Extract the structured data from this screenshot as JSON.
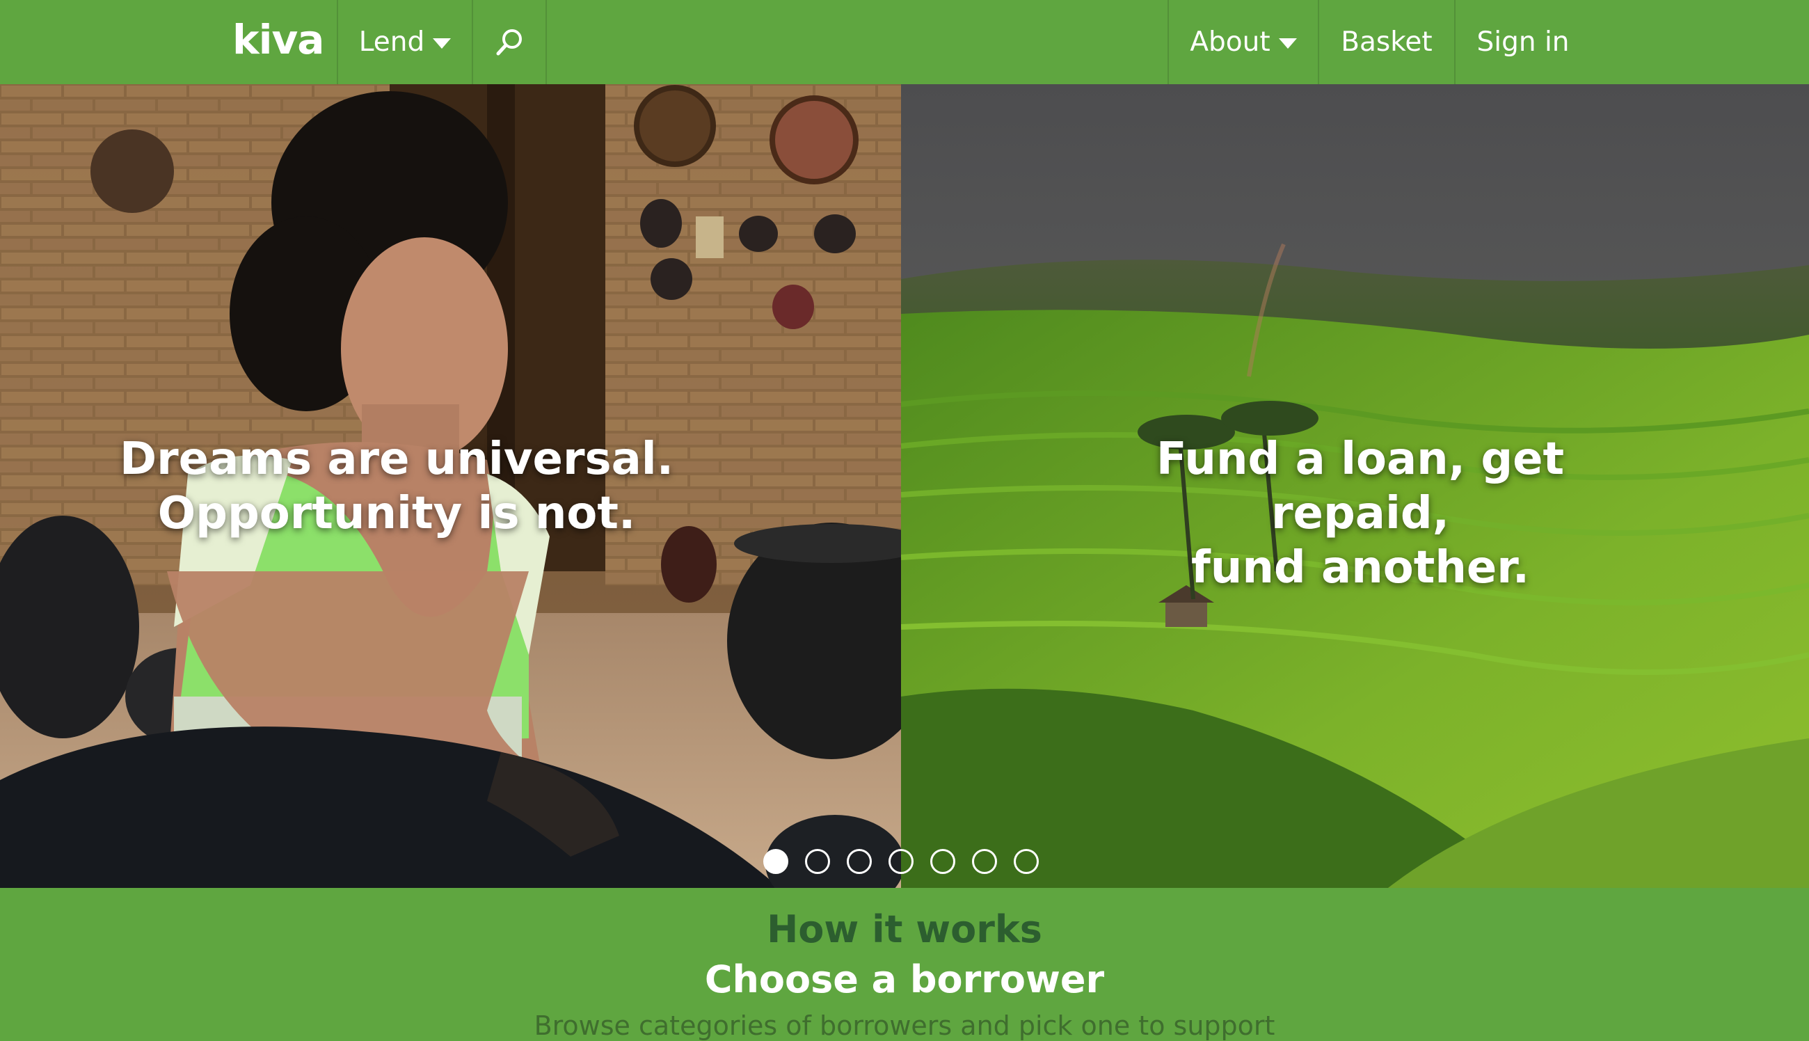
{
  "nav": {
    "logo": "kiva",
    "lend_label": "Lend",
    "search_icon": "search-icon",
    "about_label": "About",
    "basket_label": "Basket",
    "signin_label": "Sign in"
  },
  "hero": {
    "left_line1": "Dreams are universal.",
    "left_line2": "Opportunity is not.",
    "right_line1": "Fund a loan, get repaid,",
    "right_line2": "fund another.",
    "dots": {
      "count": 7,
      "active": 1
    }
  },
  "how": {
    "title": "How it works",
    "subtitle": "Choose a borrower",
    "description": "Browse categories of borrowers and pick one to support"
  },
  "colors": {
    "brand": "#5fa640",
    "heading": "#2c5e2f"
  }
}
